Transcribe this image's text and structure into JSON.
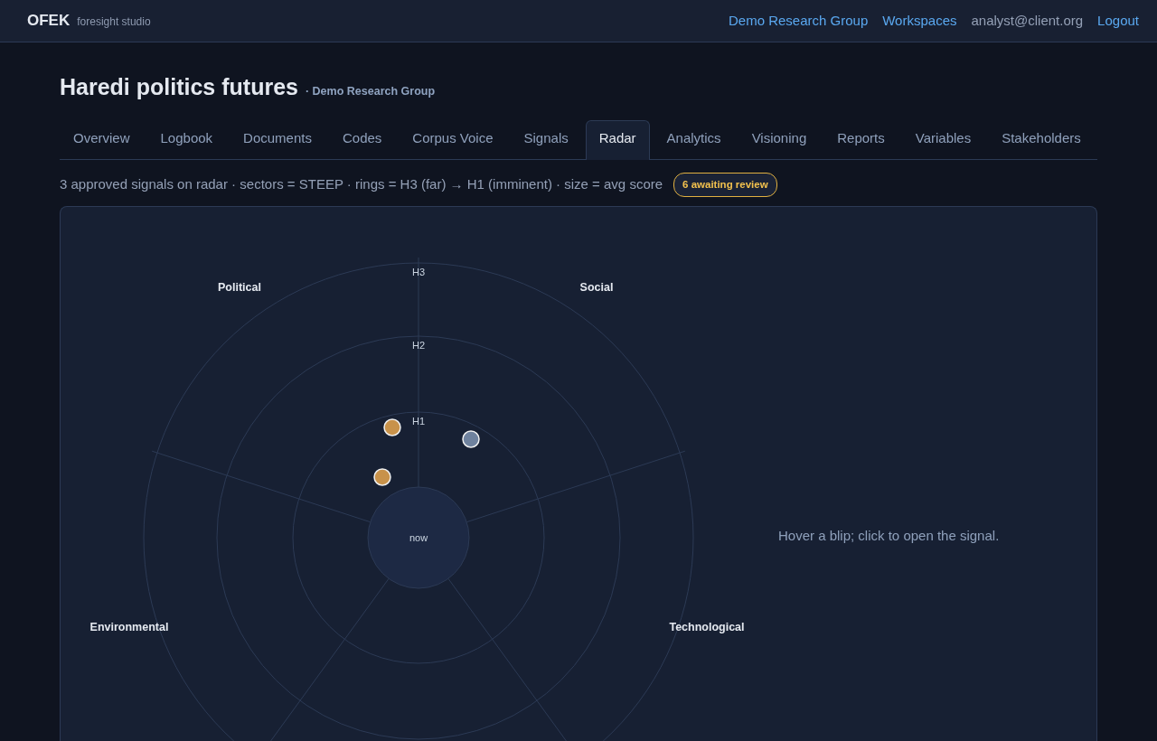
{
  "brand": {
    "name": "OFEK",
    "tagline": "foresight studio"
  },
  "nav_links": [
    {
      "label": "Demo Research Group",
      "kind": "link"
    },
    {
      "label": "Workspaces",
      "kind": "link"
    },
    {
      "label": "analyst@client.org",
      "kind": "text"
    },
    {
      "label": "Logout",
      "kind": "link"
    }
  ],
  "page": {
    "title": "Haredi politics futures",
    "subtitle": "· Demo Research Group"
  },
  "tabs": [
    {
      "label": "Overview",
      "selected": false
    },
    {
      "label": "Logbook",
      "selected": false
    },
    {
      "label": "Documents",
      "selected": false
    },
    {
      "label": "Codes",
      "selected": false
    },
    {
      "label": "Corpus Voice",
      "selected": false
    },
    {
      "label": "Signals",
      "selected": false
    },
    {
      "label": "Radar",
      "selected": true
    },
    {
      "label": "Analytics",
      "selected": false
    },
    {
      "label": "Visioning",
      "selected": false
    },
    {
      "label": "Reports",
      "selected": false
    },
    {
      "label": "Variables",
      "selected": false
    },
    {
      "label": "Stakeholders",
      "selected": false
    }
  ],
  "summary": "3 approved signals on radar · sectors = STEEP · rings = H3 (far) → H1 (imminent) · size = avg score",
  "review_badge": "6 awaiting review",
  "radar": {
    "sectors": [
      "Political",
      "Social",
      "Environmental",
      "Technological"
    ],
    "rings": [
      "H3",
      "H2",
      "H1"
    ],
    "center_label": "now",
    "blips": [
      {
        "color": "#c8924a"
      },
      {
        "color": "#6f829e"
      },
      {
        "color": "#c8924a"
      }
    ]
  },
  "hint": "Hover a blip; click to open the signal."
}
